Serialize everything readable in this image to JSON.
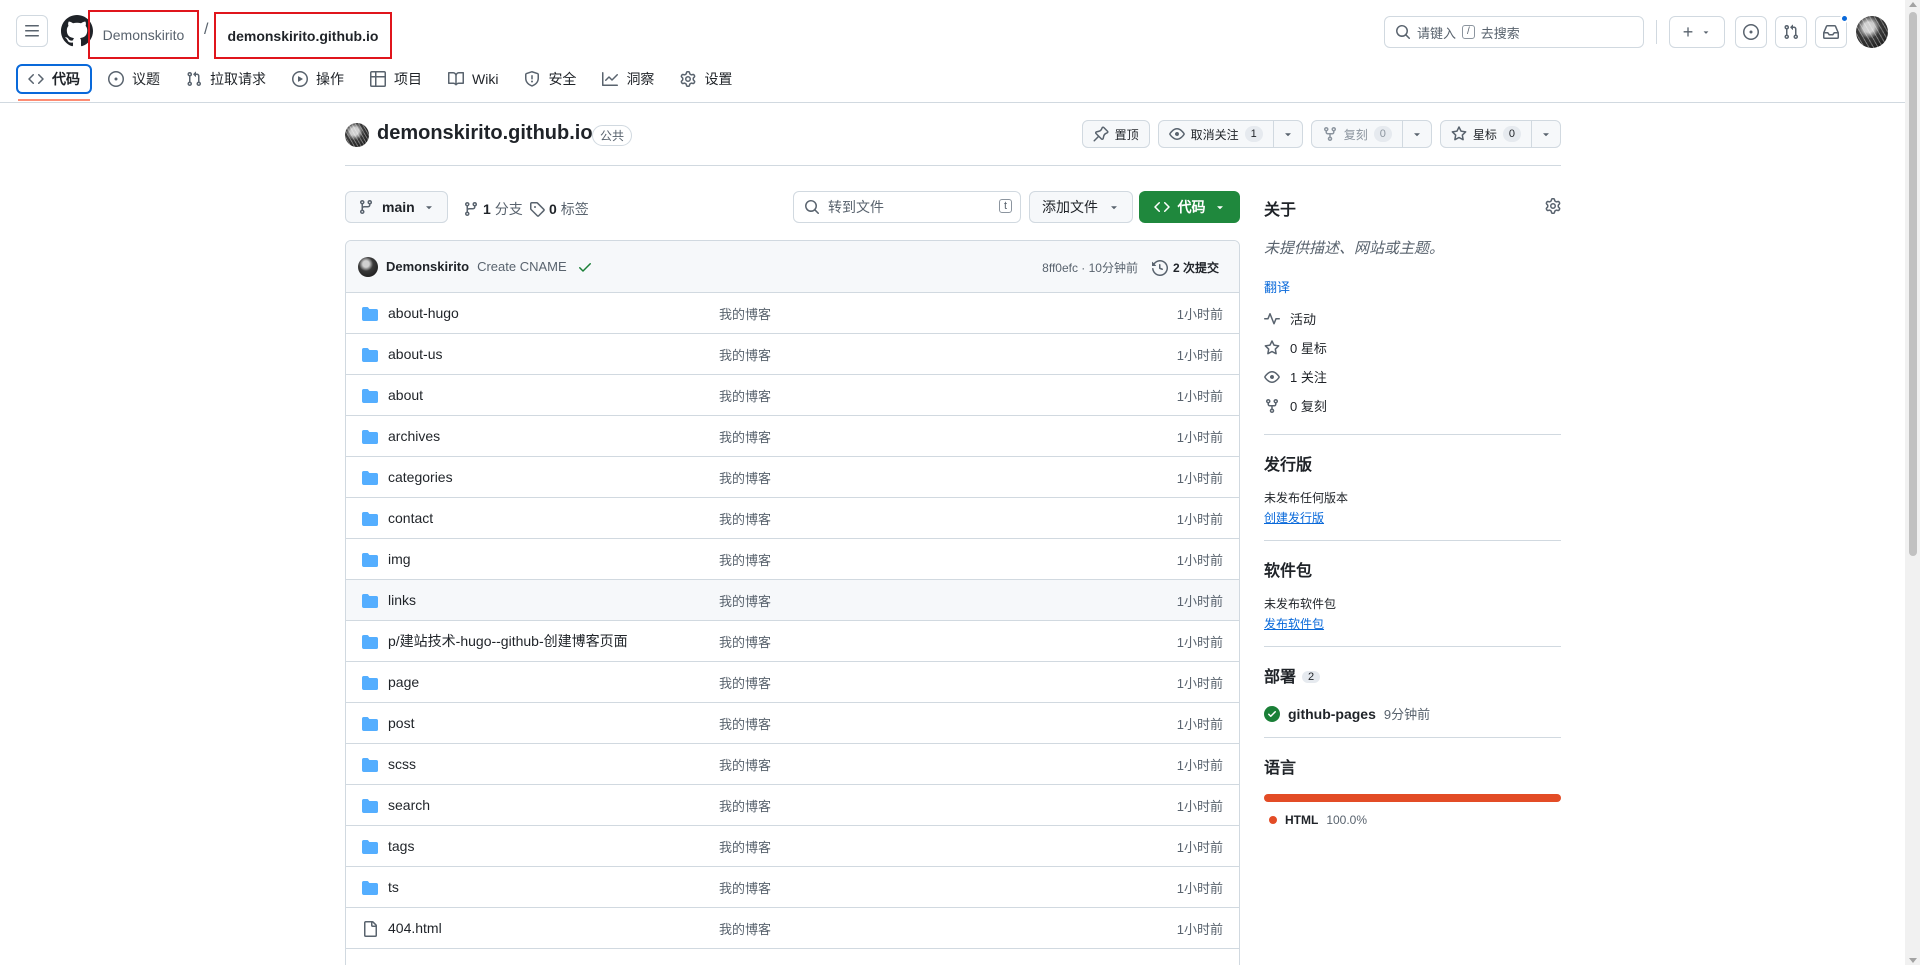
{
  "header": {
    "owner": "Demonskirito",
    "separator": "/",
    "repo": "demonskirito.github.io",
    "search_placeholder_pre": "请键入",
    "search_key": "/",
    "search_placeholder_post": "去搜索",
    "new_label": "+"
  },
  "nav": {
    "items": [
      {
        "label": "代码",
        "icon": "code-icon"
      },
      {
        "label": "议题",
        "icon": "issue-icon"
      },
      {
        "label": "拉取请求",
        "icon": "pull-request-icon"
      },
      {
        "label": "操作",
        "icon": "play-icon"
      },
      {
        "label": "项目",
        "icon": "table-icon"
      },
      {
        "label": "Wiki",
        "icon": "book-icon"
      },
      {
        "label": "安全",
        "icon": "shield-icon"
      },
      {
        "label": "洞察",
        "icon": "graph-icon"
      },
      {
        "label": "设置",
        "icon": "gear-icon"
      }
    ]
  },
  "repo": {
    "name": "demonskirito.github.io",
    "visibility": "公共",
    "pin_label": "置顶",
    "watch_label": "取消关注",
    "watch_count": "1",
    "fork_label": "复刻",
    "fork_count": "0",
    "star_label": "星标",
    "star_count": "0"
  },
  "toolbar": {
    "branch": "main",
    "branches_count": "1",
    "branches_label": "分支",
    "tags_count": "0",
    "tags_label": "标签",
    "goto_placeholder": "转到文件",
    "goto_key": "t",
    "add_file_label": "添加文件",
    "code_label": "代码"
  },
  "commit": {
    "author": "Demonskirito",
    "message": "Create CNAME",
    "hash_time": "8ff0efc · 10分钟前",
    "count_label": "2 次提交"
  },
  "files": [
    {
      "name": "about-hugo",
      "type": "folder",
      "message": "我的博客",
      "date": "1小时前"
    },
    {
      "name": "about-us",
      "type": "folder",
      "message": "我的博客",
      "date": "1小时前"
    },
    {
      "name": "about",
      "type": "folder",
      "message": "我的博客",
      "date": "1小时前"
    },
    {
      "name": "archives",
      "type": "folder",
      "message": "我的博客",
      "date": "1小时前"
    },
    {
      "name": "categories",
      "type": "folder",
      "message": "我的博客",
      "date": "1小时前"
    },
    {
      "name": "contact",
      "type": "folder",
      "message": "我的博客",
      "date": "1小时前"
    },
    {
      "name": "img",
      "type": "folder",
      "message": "我的博客",
      "date": "1小时前"
    },
    {
      "name": "links",
      "type": "folder",
      "message": "我的博客",
      "date": "1小时前"
    },
    {
      "name": "p/建站技术-hugo--github-创建博客页面",
      "type": "folder",
      "message": "我的博客",
      "date": "1小时前"
    },
    {
      "name": "page",
      "type": "folder",
      "message": "我的博客",
      "date": "1小时前"
    },
    {
      "name": "post",
      "type": "folder",
      "message": "我的博客",
      "date": "1小时前"
    },
    {
      "name": "scss",
      "type": "folder",
      "message": "我的博客",
      "date": "1小时前"
    },
    {
      "name": "search",
      "type": "folder",
      "message": "我的博客",
      "date": "1小时前"
    },
    {
      "name": "tags",
      "type": "folder",
      "message": "我的博客",
      "date": "1小时前"
    },
    {
      "name": "ts",
      "type": "folder",
      "message": "我的博客",
      "date": "1小时前"
    },
    {
      "name": "404.html",
      "type": "file",
      "message": "我的博客",
      "date": "1小时前"
    }
  ],
  "sidebar": {
    "about_title": "关于",
    "about_desc": "未提供描述、网站或主题。",
    "translate": "翻译",
    "stats": [
      {
        "icon": "pulse-icon",
        "label": "活动"
      },
      {
        "icon": "star-icon",
        "label": "0 星标"
      },
      {
        "icon": "eye-icon",
        "label": "1 关注"
      },
      {
        "icon": "fork-icon",
        "label": "0 复刻"
      }
    ],
    "releases_title": "发行版",
    "releases_note": "未发布任何版本",
    "releases_link": "创建发行版",
    "packages_title": "软件包",
    "packages_note": "未发布软件包",
    "packages_link": "发布软件包",
    "deploy_title": "部署",
    "deploy_count": "2",
    "deploy_env": "github-pages",
    "deploy_time": "9分钟前",
    "lang_title": "语言",
    "lang_name": "HTML",
    "lang_pct": "100.0%",
    "lang_color": "#e34c26"
  }
}
